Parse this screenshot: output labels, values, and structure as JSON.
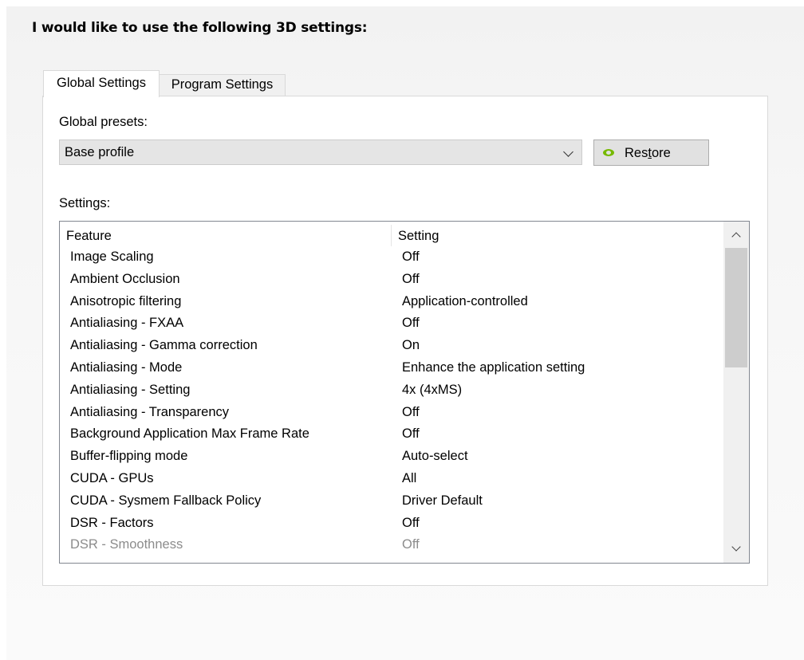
{
  "heading": "I would like to use the following 3D settings:",
  "tabs": [
    {
      "label": "Global Settings",
      "active": true
    },
    {
      "label": "Program Settings",
      "active": false
    }
  ],
  "global_presets": {
    "label": "Global presets:",
    "selected": "Base profile",
    "restore_button": {
      "pre": "Res",
      "accel": "t",
      "post": "ore",
      "icon": "nvidia-logo-icon"
    }
  },
  "settings": {
    "label": "Settings:",
    "columns": {
      "feature": "Feature",
      "setting": "Setting"
    },
    "rows": [
      {
        "feature": "Image Scaling",
        "setting": "Off"
      },
      {
        "feature": "Ambient Occlusion",
        "setting": "Off"
      },
      {
        "feature": "Anisotropic filtering",
        "setting": "Application-controlled"
      },
      {
        "feature": "Antialiasing - FXAA",
        "setting": "Off"
      },
      {
        "feature": "Antialiasing - Gamma correction",
        "setting": "On"
      },
      {
        "feature": "Antialiasing - Mode",
        "setting": "Enhance the application setting"
      },
      {
        "feature": "Antialiasing - Setting",
        "setting": "4x (4xMS)"
      },
      {
        "feature": "Antialiasing - Transparency",
        "setting": "Off"
      },
      {
        "feature": "Background Application Max Frame Rate",
        "setting": "Off"
      },
      {
        "feature": "Buffer-flipping mode",
        "setting": "Auto-select"
      },
      {
        "feature": "CUDA - GPUs",
        "setting": "All"
      },
      {
        "feature": "CUDA - Sysmem Fallback Policy",
        "setting": "Driver Default"
      },
      {
        "feature": "DSR - Factors",
        "setting": "Off"
      },
      {
        "feature": "DSR - Smoothness",
        "setting": "Off",
        "disabled": true
      }
    ]
  },
  "colors": {
    "accent_nvidia": "#76b900",
    "disabled_text": "#8c8c8c"
  }
}
